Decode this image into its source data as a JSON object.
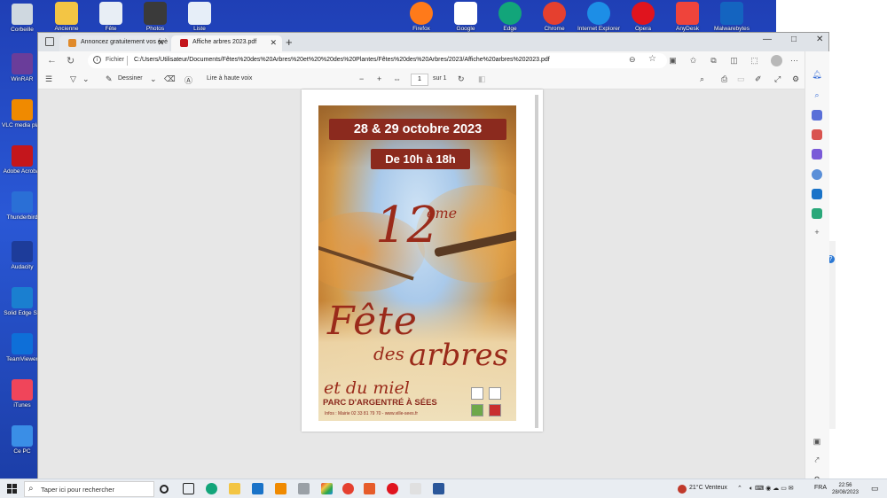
{
  "desktop": {
    "left_icons": [
      {
        "label": "Corbeille",
        "icon": "recycle-bin-icon",
        "color": "#cfd8e0"
      },
      {
        "label": "WinRAR",
        "icon": "winrar-icon",
        "color": "#6a3d9a"
      },
      {
        "label": "VLC media player",
        "icon": "vlc-icon",
        "color": "#f08a00"
      },
      {
        "label": "Adobe Acrobat",
        "icon": "acrobat-icon",
        "color": "#c4161c"
      },
      {
        "label": "Thunderbird",
        "icon": "thunderbird-icon",
        "color": "#2a6fd6"
      },
      {
        "label": "Audacity",
        "icon": "audacity-icon",
        "color": "#1d3c9a"
      },
      {
        "label": "Solid Edge ST",
        "icon": "solid-edge-icon",
        "color": "#1a7fd0"
      },
      {
        "label": "TeamViewer",
        "icon": "teamviewer-icon",
        "color": "#0e6fd8"
      },
      {
        "label": "iTunes",
        "icon": "itunes-icon",
        "color": "#f0455a"
      },
      {
        "label": "Ce PC",
        "icon": "this-pc-icon",
        "color": "#3a8ee6"
      }
    ],
    "top_icons": [
      {
        "label": "Ancienne",
        "icon": "folder-icon",
        "color": "#f3c544"
      },
      {
        "label": "Fête",
        "icon": "clock-icon",
        "color": "#e8eef5"
      },
      {
        "label": "Photos",
        "icon": "photo-icon",
        "color": "#3a3a3a"
      },
      {
        "label": "Liste",
        "icon": "document-icon",
        "color": "#e6eef8"
      },
      {
        "label": "Firefox",
        "icon": "firefox-icon",
        "color": "#ff7a1a"
      },
      {
        "label": "Google",
        "icon": "google-icon",
        "color": "#ffffff"
      },
      {
        "label": "Edge",
        "icon": "edge-icon",
        "color": "#12a57a"
      },
      {
        "label": "Chrome",
        "icon": "chrome-icon",
        "color": "#e5402f"
      },
      {
        "label": "Internet Explorer",
        "icon": "ie-icon",
        "color": "#1d8ee6"
      },
      {
        "label": "Opera",
        "icon": "opera-icon",
        "color": "#e0141e"
      },
      {
        "label": "AnyDesk",
        "icon": "anydesk-icon",
        "color": "#ef443b"
      },
      {
        "label": "Malwarebytes",
        "icon": "malwarebytes-icon",
        "color": "#1464c0"
      }
    ]
  },
  "browser": {
    "tabs": [
      {
        "title": "Annoncez gratuitement vos évè",
        "active": false
      },
      {
        "title": "Affiche arbres 2023.pdf",
        "active": true
      }
    ],
    "new_tab": "+",
    "window_controls": [
      "—",
      "□",
      "✕"
    ],
    "address": {
      "scheme": "Fichier",
      "url": "C:/Users/Utilisateur/Documents/Fêtes%20des%20Arbres%20et%20%20des%20Plantes/Fêtes%20des%20Arbres/2023/Affiche%20arbres%202023.pdf"
    },
    "pdf_toolbar": {
      "draw_label": "Dessiner",
      "read_aloud_label": "Lire à haute voix",
      "page_current": "1",
      "page_total": "sur 1"
    }
  },
  "poster": {
    "dates": "28 & 29 octobre 2023",
    "hours": "De 10h à 18h",
    "edition_number": "12",
    "edition_suffix": "ème",
    "title_line1": "Fête",
    "title_des": "des",
    "title_arbres": "arbres",
    "subtitle": "et du miel",
    "venue": "PARC D'ARGENTRÉ À SÉES",
    "info": "Infos : Mairie 02 33 81 79 70 - www.ville-sees.fr",
    "accent_color": "#8b2a1e"
  },
  "taskbar": {
    "search_placeholder": "Taper ici pour rechercher",
    "weather": "21°C  Venteux",
    "language": "FRA",
    "time": "22:56",
    "date": "28/08/2023"
  }
}
